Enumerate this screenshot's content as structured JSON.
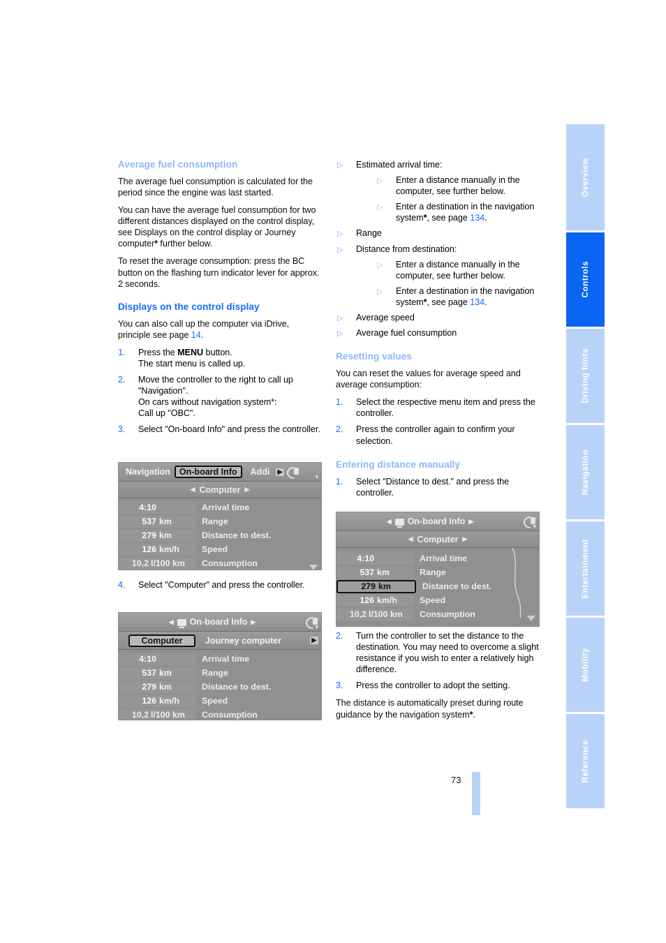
{
  "page": {
    "number": "73",
    "accent_blue": "#0d6efd",
    "light_blue": "#8cb8f5",
    "tab_blue": "#b9d3f8",
    "tab_active_blue": "#0a66f2"
  },
  "sidebar": {
    "tabs": [
      {
        "label": "Overview",
        "active": false
      },
      {
        "label": "Controls",
        "active": true
      },
      {
        "label": "Driving hints",
        "active": false
      },
      {
        "label": "Navigation",
        "active": false
      },
      {
        "label": "Entertainment",
        "active": false
      },
      {
        "label": "Mobility",
        "active": false
      },
      {
        "label": "Reference",
        "active": false
      }
    ]
  },
  "left_column": {
    "heading_avg": "Average fuel consumption",
    "p1": "The average fuel consumption is calculated for the period since the engine was last started.",
    "p2_a": "You can have the average fuel consumption for two different distances displayed on the control display, see Displays on the control display or Journey computer",
    "p2_star": "*",
    "p2_b": " further below.",
    "p3": "To reset the average consumption: press the BC button on the flashing turn indicator lever for approx. 2 seconds.",
    "heading_displays": "Displays on the control display",
    "p4_a": "You can also call up the computer via iDrive, principle see page ",
    "p4_page": "14",
    "p4_b": ".",
    "steps": [
      {
        "num": "1.",
        "pre": "Press the ",
        "bold": "MENU",
        "post": " button.",
        "extra": "The start menu is called up."
      },
      {
        "num": "2.",
        "pre": "Move the controller to the right to call up \"Navigation\".",
        "bold": "",
        "post": "",
        "extra": "On cars without navigation system*:",
        "extra2": "Call up \"OBC\"."
      },
      {
        "num": "3.",
        "pre": "Select \"On-board Info\" and press the controller.",
        "bold": "",
        "post": "",
        "extra": ""
      }
    ],
    "step4": {
      "num": "4.",
      "text": "Select \"Computer\" and press the controller."
    }
  },
  "right_column": {
    "bullets": [
      {
        "text": "Estimated arrival time:",
        "sub": [
          {
            "a": "Enter a distance manually in the computer, see further below.",
            "star": "",
            "b": "",
            "page": "",
            "c": ""
          },
          {
            "a": "Enter a destination in the navigation system",
            "star": "*",
            "b": ", see page ",
            "page": "134",
            "c": "."
          }
        ]
      },
      {
        "text": "Range",
        "sub": []
      },
      {
        "text": "Distance from destination:",
        "sub": [
          {
            "a": "Enter a distance manually in the computer, see further below.",
            "star": "",
            "b": "",
            "page": "",
            "c": ""
          },
          {
            "a": "Enter a destination in the navigation system",
            "star": "*",
            "b": ", see page ",
            "page": "134",
            "c": "."
          }
        ]
      },
      {
        "text": "Average speed",
        "sub": []
      },
      {
        "text": "Average fuel consumption",
        "sub": []
      }
    ],
    "heading_resetting": "Resetting values",
    "reset_intro": "You can reset the values for average speed and average consumption:",
    "reset_steps": [
      {
        "num": "1.",
        "text": "Select the respective menu item and press the controller."
      },
      {
        "num": "2.",
        "text": "Press the controller again to confirm your selection."
      }
    ],
    "heading_entering": "Entering distance manually",
    "enter_step1": {
      "num": "1.",
      "text": "Select \"Distance to dest.\" and press the controller."
    },
    "enter_steps_after": [
      {
        "num": "2.",
        "text": "Turn the controller to set the distance to the destination. You may need to overcome a slight resistance if you wish to enter a relatively high difference."
      },
      {
        "num": "3.",
        "text": "Press the controller to adopt the setting."
      }
    ],
    "closing_a": "The distance is automatically preset during route guidance by the navigation system",
    "closing_star": "*",
    "closing_b": "."
  },
  "figures": {
    "fig1": {
      "tabs": [
        "Navigation",
        "On-board Info",
        "Addi"
      ],
      "selected_tab": "On-board Info",
      "subtitle": "Computer",
      "rows": [
        {
          "value": "4:10",
          "unit": "",
          "label": "Arrival time",
          "highlight": false
        },
        {
          "value": "537",
          "unit": "km",
          "label": "Range",
          "highlight": false
        },
        {
          "value": "279",
          "unit": "km",
          "label": "Distance to dest.",
          "highlight": false
        },
        {
          "value": "126",
          "unit": "km/h",
          "label": "Speed",
          "highlight": false
        },
        {
          "value": "10,2",
          "unit": "l/100 km",
          "label": "Consumption",
          "highlight": false
        }
      ]
    },
    "fig2": {
      "title": "On-board Info",
      "tabs": [
        "Computer",
        "Journey computer"
      ],
      "selected_tab": "Computer",
      "rows": [
        {
          "value": "4:10",
          "unit": "",
          "label": "Arrival time",
          "highlight": false
        },
        {
          "value": "537",
          "unit": "km",
          "label": "Range",
          "highlight": false
        },
        {
          "value": "279",
          "unit": "km",
          "label": "Distance to dest.",
          "highlight": false
        },
        {
          "value": "126",
          "unit": "km/h",
          "label": "Speed",
          "highlight": false
        },
        {
          "value": "10,2",
          "unit": "l/100 km",
          "label": "Consumption",
          "highlight": false
        }
      ]
    },
    "fig3": {
      "title": "On-board Info",
      "subtitle": "Computer",
      "rows": [
        {
          "value": "4:10",
          "unit": "",
          "label": "Arrival time",
          "highlight": false
        },
        {
          "value": "537",
          "unit": "km",
          "label": "Range",
          "highlight": false
        },
        {
          "value": "279",
          "unit": "km",
          "label": "Distance to dest.",
          "highlight": true
        },
        {
          "value": "126",
          "unit": "km/h",
          "label": "Speed",
          "highlight": false
        },
        {
          "value": "10,2",
          "unit": "l/100 km",
          "label": "Consumption",
          "highlight": false
        }
      ]
    }
  }
}
